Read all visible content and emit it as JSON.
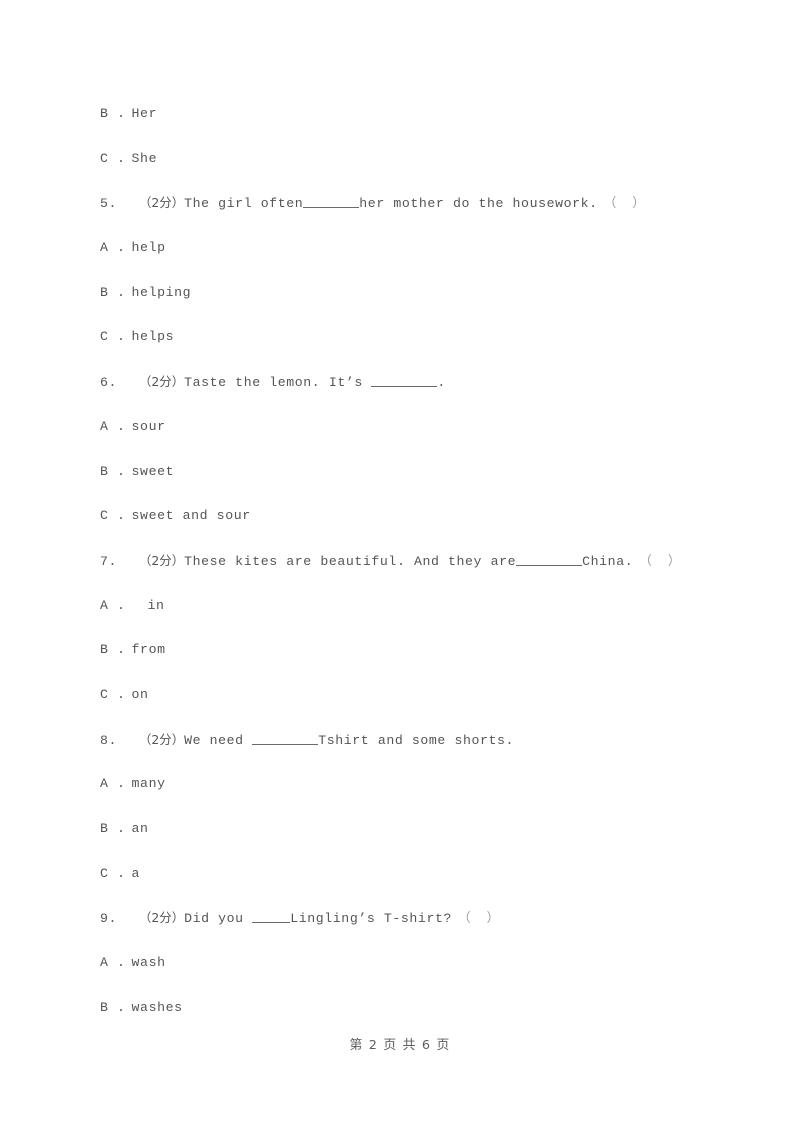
{
  "document": {
    "page_footer": "第 2 页 共 6 页",
    "marks_label": "（2分）",
    "answer_bracket": "（    ）"
  },
  "items": [
    {
      "kind": "option",
      "marker": "B .",
      "text": "Her"
    },
    {
      "kind": "option",
      "marker": "C .",
      "text": "She"
    },
    {
      "kind": "question",
      "number": "5.",
      "marks": "（2分）",
      "before": "The girl often",
      "blank": "md",
      "after": "her mother do the housework.",
      "bracket": "（    ）"
    },
    {
      "kind": "option",
      "marker": "A .",
      "text": "help"
    },
    {
      "kind": "option",
      "marker": "B .",
      "text": "helping"
    },
    {
      "kind": "option",
      "marker": "C .",
      "text": "helps"
    },
    {
      "kind": "question",
      "number": "6.",
      "marks": "（2分）",
      "before": "Taste the lemon. It’s ",
      "blank": "lg",
      "after": ".",
      "bracket": ""
    },
    {
      "kind": "option",
      "marker": "A .",
      "text": "sour"
    },
    {
      "kind": "option",
      "marker": "B .",
      "text": "sweet"
    },
    {
      "kind": "option",
      "marker": "C .",
      "text": "sweet and sour"
    },
    {
      "kind": "question",
      "number": "7.",
      "marks": "（2分）",
      "before": "These kites are beautiful. And they are",
      "blank": "lg",
      "after": "China.",
      "bracket": "（    ）"
    },
    {
      "kind": "option",
      "marker": "A .",
      "text": "in",
      "indent": true
    },
    {
      "kind": "option",
      "marker": "B .",
      "text": "from"
    },
    {
      "kind": "option",
      "marker": "C .",
      "text": "on"
    },
    {
      "kind": "question",
      "number": "8.",
      "marks": "（2分）",
      "before": "We need ",
      "blank": "lg",
      "after": "Tshirt and some shorts.",
      "bracket": ""
    },
    {
      "kind": "option",
      "marker": "A .",
      "text": "many"
    },
    {
      "kind": "option",
      "marker": "B .",
      "text": "an"
    },
    {
      "kind": "option",
      "marker": "C .",
      "text": "a"
    },
    {
      "kind": "question",
      "number": "9.",
      "marks": "（2分）",
      "before": "Did you ",
      "blank": "sm",
      "after": "Lingling’s T-shirt?",
      "bracket": "（    ）"
    },
    {
      "kind": "option",
      "marker": "A .",
      "text": "wash"
    },
    {
      "kind": "option",
      "marker": "B .",
      "text": "washes"
    }
  ]
}
